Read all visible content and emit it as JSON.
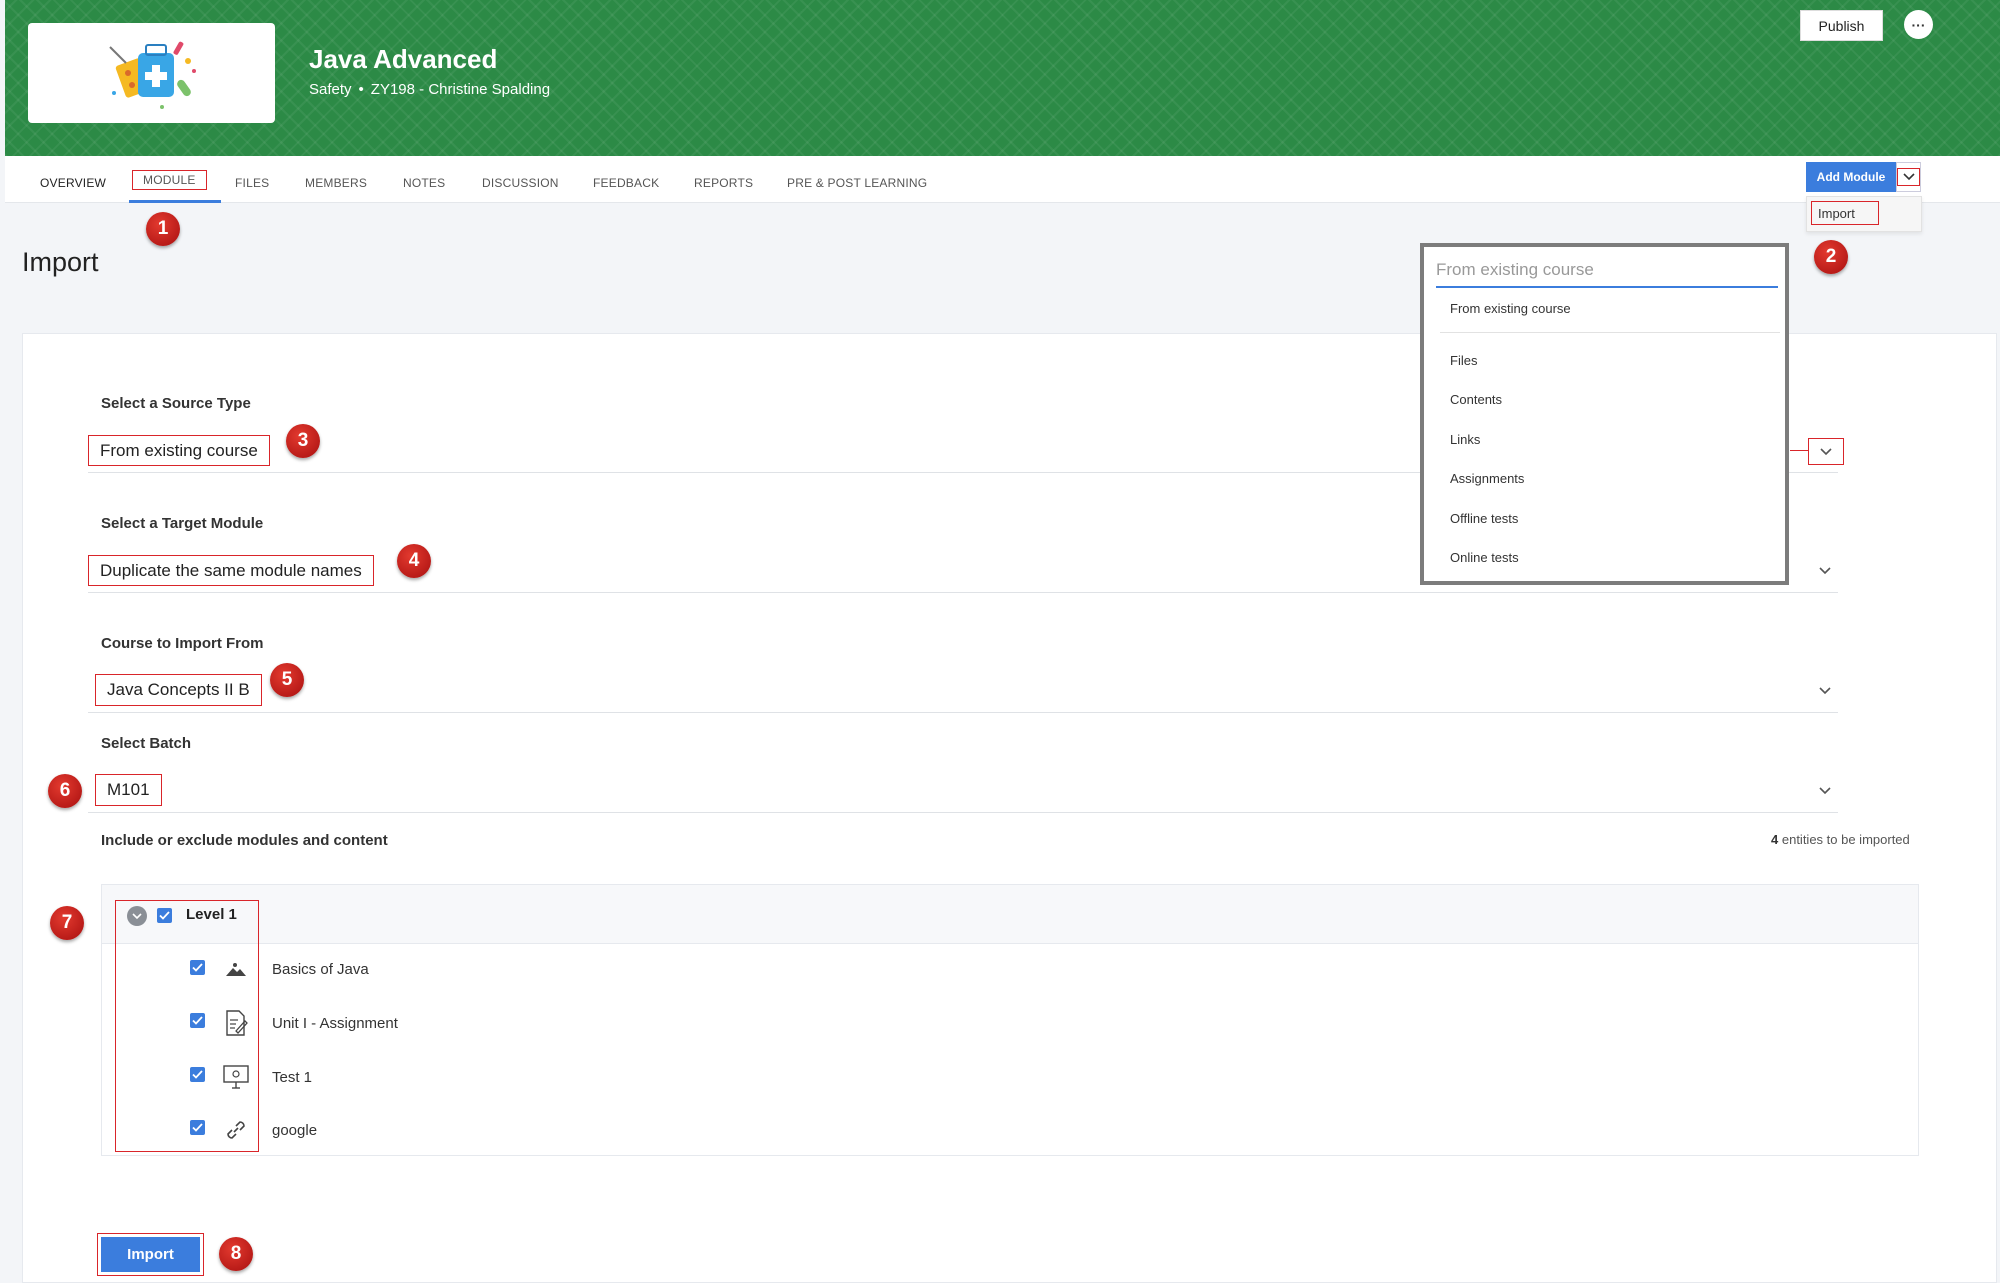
{
  "header": {
    "course_title": "Java Advanced",
    "category": "Safety",
    "course_code_owner": "ZY198 - Christine Spalding",
    "publish_label": "Publish",
    "more_label": "···"
  },
  "tabs": [
    {
      "label": "OVERVIEW"
    },
    {
      "label": "MODULE"
    },
    {
      "label": "FILES"
    },
    {
      "label": "MEMBERS"
    },
    {
      "label": "NOTES"
    },
    {
      "label": "DISCUSSION"
    },
    {
      "label": "FEEDBACK"
    },
    {
      "label": "REPORTS"
    },
    {
      "label": "PRE & POST LEARNING"
    }
  ],
  "add_module": {
    "label": "Add Module",
    "menu_item": "Import"
  },
  "page": {
    "title": "Import"
  },
  "form": {
    "source_type": {
      "label": "Select a Source Type",
      "value": "From existing course"
    },
    "target_module": {
      "label": "Select a Target Module",
      "value": "Duplicate the same module names"
    },
    "course_from": {
      "label": "Course to Import From",
      "value": "Java Concepts II B"
    },
    "batch": {
      "label": "Select Batch",
      "value": "M101"
    },
    "include_label": "Include or exclude modules and content",
    "entities_count": "4",
    "entities_text": "entities to be imported"
  },
  "source_dropdown": {
    "placeholder": "From existing course",
    "options": [
      "From existing course",
      "Files",
      "Contents",
      "Links",
      "Assignments",
      "Offline tests",
      "Online tests"
    ]
  },
  "tree": {
    "level_label": "Level 1",
    "items": [
      {
        "label": "Basics of Java",
        "icon": "image-icon"
      },
      {
        "label": "Unit I - Assignment",
        "icon": "assignment-icon"
      },
      {
        "label": "Test 1",
        "icon": "online-test-icon"
      },
      {
        "label": "google",
        "icon": "link-icon"
      }
    ]
  },
  "import_button": {
    "label": "Import"
  },
  "callouts": [
    "1",
    "2",
    "3",
    "4",
    "5",
    "6",
    "7",
    "8"
  ],
  "colors": {
    "banner": "#2c8a46",
    "primary": "#3b7ddd",
    "highlight": "#d9252a",
    "badge": "#c0171b"
  }
}
